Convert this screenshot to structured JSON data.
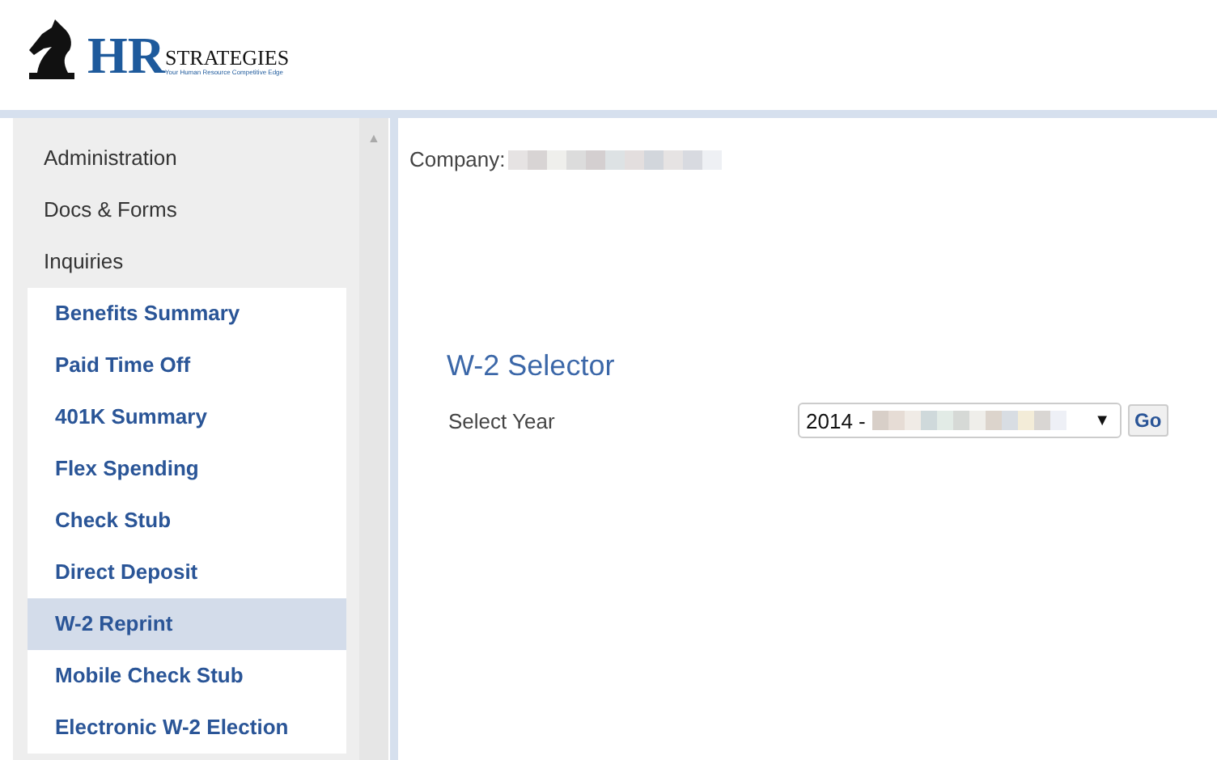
{
  "logo": {
    "big": "HR",
    "small": "STRATEGIES",
    "tagline": "Your Human Resource Competitive Edge"
  },
  "sidebar": {
    "items": [
      {
        "label": "Administration",
        "selected": false
      },
      {
        "label": "Docs & Forms",
        "selected": false
      },
      {
        "label": "Inquiries",
        "selected": false,
        "children": [
          {
            "label": "Benefits Summary",
            "selected": false
          },
          {
            "label": "Paid Time Off",
            "selected": false
          },
          {
            "label": "401K Summary",
            "selected": false
          },
          {
            "label": "Flex Spending",
            "selected": false
          },
          {
            "label": "Check Stub",
            "selected": false
          },
          {
            "label": "Direct Deposit",
            "selected": false
          },
          {
            "label": "W-2 Reprint",
            "selected": true
          },
          {
            "label": "Mobile Check Stub",
            "selected": false
          },
          {
            "label": "Electronic W-2 Election",
            "selected": false
          }
        ]
      }
    ],
    "scroll_up": "▲"
  },
  "company": {
    "label": "Company:"
  },
  "selector": {
    "title": "W-2 Selector",
    "label": "Select Year",
    "value": "2014 -",
    "arrow": "▼",
    "button": "Go"
  }
}
